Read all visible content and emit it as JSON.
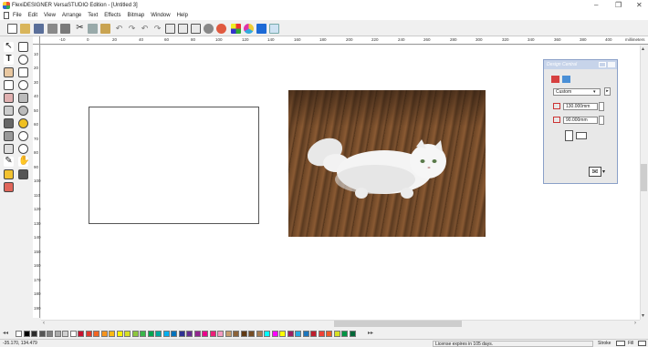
{
  "app": {
    "title": "FlexiDESIGNER VersaSTUDIO Edition - [Untitled 3]",
    "window_controls": [
      "–",
      "❐",
      "✕"
    ],
    "mdi_controls": [
      "_",
      "▫",
      "x"
    ]
  },
  "menu": [
    "File",
    "Edit",
    "View",
    "Arrange",
    "Text",
    "Effects",
    "Bitmap",
    "Window",
    "Help"
  ],
  "ruler": {
    "unit_label": "millimeters",
    "h_ticks": [
      "-10",
      "0",
      "20",
      "40",
      "60",
      "80",
      "100",
      "120",
      "140",
      "160",
      "180",
      "200",
      "220",
      "240",
      "260",
      "280",
      "300",
      "320",
      "340",
      "360",
      "380",
      "400"
    ],
    "v_ticks": [
      "10",
      "20",
      "30",
      "40",
      "50",
      "60",
      "70",
      "80",
      "90",
      "100",
      "110",
      "120",
      "130",
      "140",
      "150",
      "160",
      "170",
      "180",
      "190"
    ]
  },
  "design_central": {
    "title": "Design Central",
    "preset": "Custom",
    "width_value": "130.000mm",
    "height_value": "90.000mm"
  },
  "status": {
    "coords": "-35.170, 134.479",
    "license": "License expires in 105 days.",
    "stroke_label": "Stroke",
    "fill_label": "Fill"
  },
  "colors": {
    "palette": [
      "#ffffff",
      "#000000",
      "#2b2b2b",
      "#555555",
      "#808080",
      "#aaaaaa",
      "#d0d0d0",
      "#ffffff",
      "#c8102e",
      "#e03a2f",
      "#f26522",
      "#f7941d",
      "#fdb913",
      "#fff200",
      "#d7df23",
      "#8dc63f",
      "#39b54a",
      "#00a651",
      "#00a99d",
      "#00aeef",
      "#0072bc",
      "#2e3192",
      "#662d91",
      "#92278f",
      "#ec008c",
      "#ed1e79",
      "#f49ac1",
      "#c69c6d",
      "#8c6239",
      "#603913",
      "#754c24",
      "#a67c52",
      "#00ffff",
      "#ff00ff",
      "#ffff00",
      "#9e1f63",
      "#27aae1",
      "#1c75bc",
      "#be1e2d",
      "#ef4136",
      "#f15a29",
      "#d7df23",
      "#009444",
      "#006838"
    ]
  }
}
